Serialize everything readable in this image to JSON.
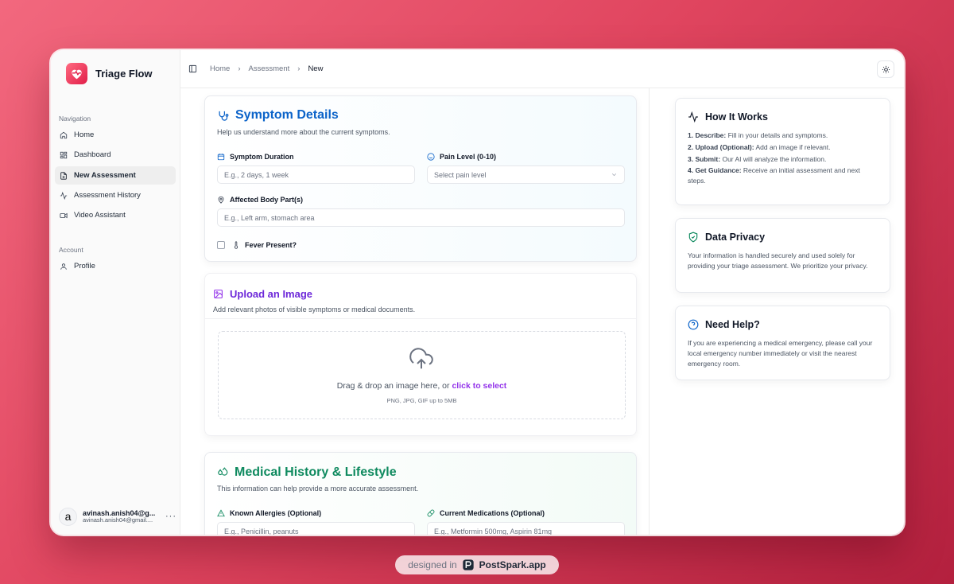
{
  "app": {
    "name": "Triage Flow"
  },
  "sidebar": {
    "nav_label": "Navigation",
    "items": [
      {
        "label": "Home",
        "icon": "home-icon"
      },
      {
        "label": "Dashboard",
        "icon": "dashboard-icon"
      },
      {
        "label": "New Assessment",
        "icon": "file-icon",
        "active": true
      },
      {
        "label": "Assessment History",
        "icon": "activity-icon"
      },
      {
        "label": "Video Assistant",
        "icon": "video-icon"
      }
    ],
    "account_label": "Account",
    "account_items": [
      {
        "label": "Profile",
        "icon": "user-icon"
      }
    ],
    "user": {
      "initial": "a",
      "name": "avinash.anish04@g...",
      "email": "avinash.anish04@gmail...."
    }
  },
  "header": {
    "breadcrumb": [
      "Home",
      "Assessment",
      "New"
    ]
  },
  "symptom_details": {
    "title": "Symptom Details",
    "description": "Help us understand more about the current symptoms.",
    "duration_label": "Symptom Duration",
    "duration_placeholder": "E.g., 2 days, 1 week",
    "pain_label": "Pain Level (0-10)",
    "pain_placeholder": "Select pain level",
    "body_part_label": "Affected Body Part(s)",
    "body_part_placeholder": "E.g., Left arm, stomach area",
    "fever_label": "Fever Present?"
  },
  "upload": {
    "title": "Upload an Image",
    "description": "Add relevant photos of visible symptoms or medical documents.",
    "drop_text": "Drag & drop an image here, or ",
    "drop_link": "click to select",
    "formats": "PNG, JPG, GIF up to 5MB"
  },
  "medical_history": {
    "title": "Medical History & Lifestyle",
    "description": "This information can help provide a more accurate assessment.",
    "allergies_label": "Known Allergies (Optional)",
    "allergies_placeholder": "E.g., Penicillin, peanuts",
    "medications_label": "Current Medications (Optional)",
    "medications_placeholder": "E.g., Metformin 500mg, Aspirin 81mg"
  },
  "how_it_works": {
    "title": "How It Works",
    "steps": [
      {
        "label": "1. Describe:",
        "text": " Fill in your details and symptoms."
      },
      {
        "label": "2. Upload (Optional):",
        "text": " Add an image if relevant."
      },
      {
        "label": "3. Submit:",
        "text": " Our AI will analyze the information."
      },
      {
        "label": "4. Get Guidance:",
        "text": " Receive an initial assessment and next steps."
      }
    ]
  },
  "data_privacy": {
    "title": "Data Privacy",
    "text": "Your information is handled securely and used solely for providing your triage assessment. We prioritize your privacy."
  },
  "need_help": {
    "title": "Need Help?",
    "text": "If you are experiencing a medical emergency, please call your local emergency number immediately or visit the nearest emergency room."
  },
  "footer": {
    "prefix": "designed in",
    "brand": "PostSpark.app"
  },
  "colors": {
    "accent": "#e11d48",
    "blue": "#0b63c9",
    "purple": "#6d28d9",
    "green": "#0f8a5f",
    "link": "#9333ea"
  }
}
